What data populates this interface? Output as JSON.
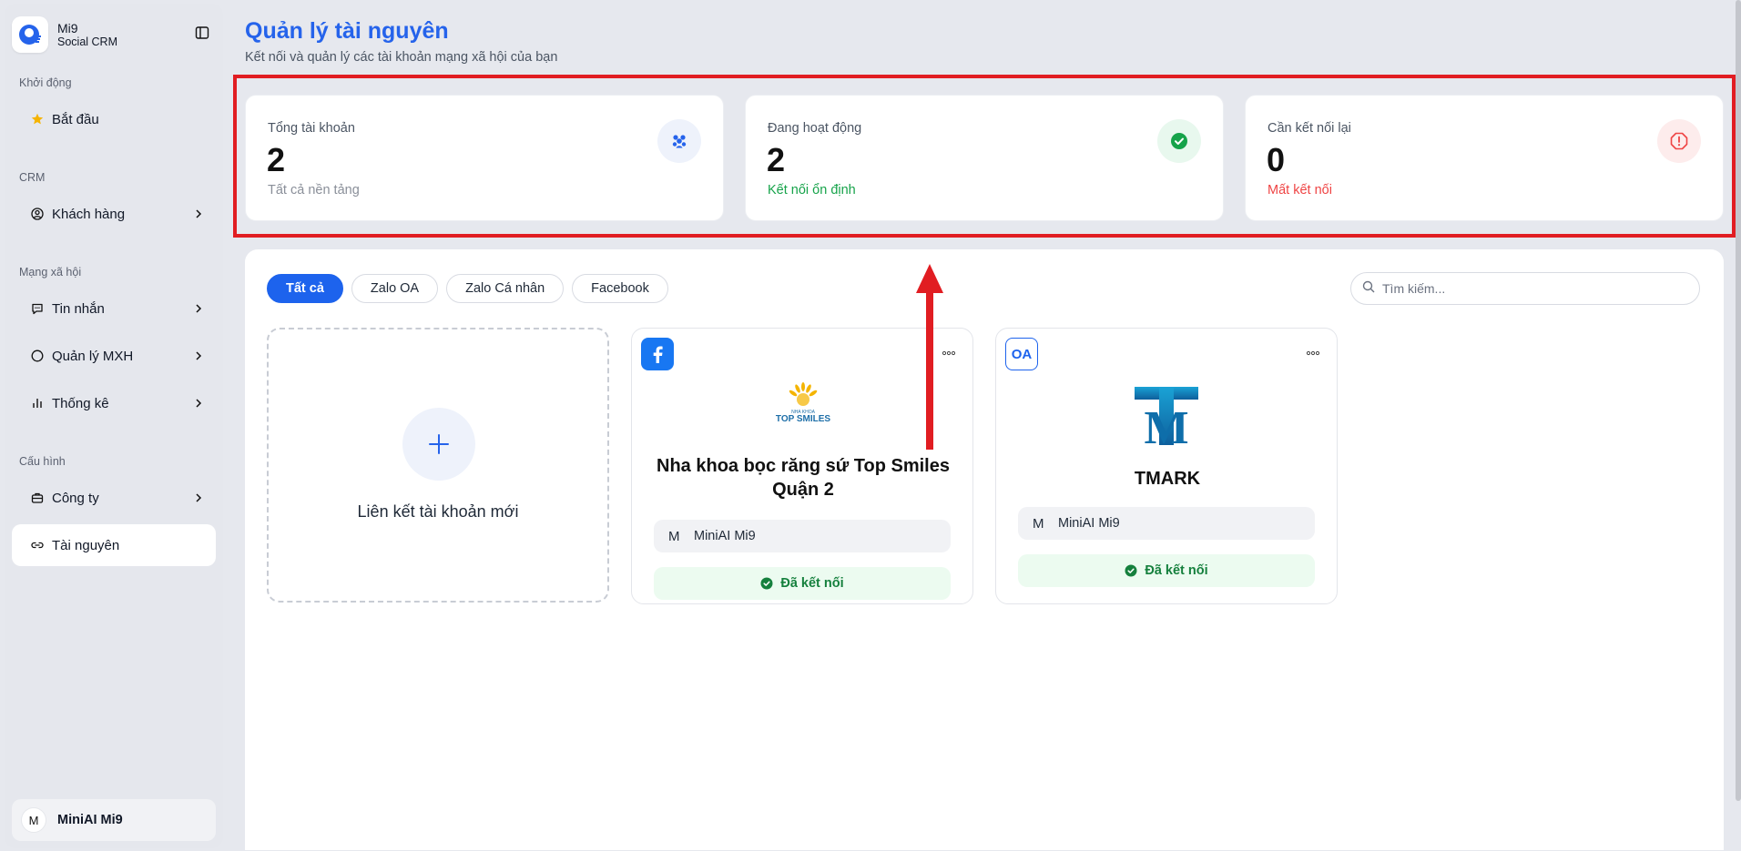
{
  "app": {
    "name": "Mi9",
    "subtitle": "Social CRM"
  },
  "sidebar": {
    "sections": [
      {
        "label": "Khởi động"
      },
      {
        "label": "CRM"
      },
      {
        "label": "Mạng xã hội"
      },
      {
        "label": "Cấu hình"
      }
    ],
    "items": [
      {
        "label": "Bắt đầu",
        "icon": "star-icon"
      },
      {
        "label": "Khách hàng",
        "icon": "user-circle-icon"
      },
      {
        "label": "Tin nhắn",
        "icon": "message-icon"
      },
      {
        "label": "Quản lý MXH",
        "icon": "spinner-icon"
      },
      {
        "label": "Thống kê",
        "icon": "bar-chart-icon"
      },
      {
        "label": "Công ty",
        "icon": "briefcase-icon"
      },
      {
        "label": "Tài nguyên",
        "icon": "link-icon",
        "active": true
      }
    ],
    "user": {
      "initial": "M",
      "name": "MiniAI Mi9"
    }
  },
  "header": {
    "title": "Quản lý tài nguyên",
    "subtitle": "Kết nối và quản lý các tài khoản mạng xã hội của bạn"
  },
  "stats": [
    {
      "label": "Tổng tài khoản",
      "value": "2",
      "note": "Tất cả nền tảng",
      "note_color": "#8a8f99",
      "icon": "users-icon"
    },
    {
      "label": "Đang hoạt động",
      "value": "2",
      "note": "Kết nối ổn định",
      "note_color": "#16a34a",
      "icon": "check-circle-icon"
    },
    {
      "label": "Cần kết nối lại",
      "value": "0",
      "note": "Mất kết nối",
      "note_color": "#ef4444",
      "icon": "alert-octagon-icon"
    }
  ],
  "filters": {
    "tabs": [
      "Tất cả",
      "Zalo OA",
      "Zalo Cá nhân",
      "Facebook"
    ],
    "active": "Tất cả"
  },
  "search": {
    "placeholder": "Tìm kiếm..."
  },
  "add_card": {
    "label": "Liên kết tài khoản mới"
  },
  "accounts": [
    {
      "platform": "facebook-icon",
      "logo": "top-smiles-logo",
      "logo_text": "TOP SMILES",
      "logo_small": "NHA KHOA",
      "name": "Nha khoa bọc răng sứ Top Smiles Quận 2",
      "owner_initial": "M",
      "owner": "MiniAI Mi9",
      "status": "Đã kết nối"
    },
    {
      "platform": "zalo-oa-icon",
      "platform_text": "OA",
      "logo": "tmark-logo",
      "logo_text": "M",
      "name": "TMARK",
      "owner_initial": "M",
      "owner": "MiniAI Mi9",
      "status": "Đã kết nối"
    }
  ],
  "colors": {
    "accent": "#2563eb",
    "highlight": "#e11d22",
    "success": "#16a34a",
    "danger": "#ef4444"
  }
}
